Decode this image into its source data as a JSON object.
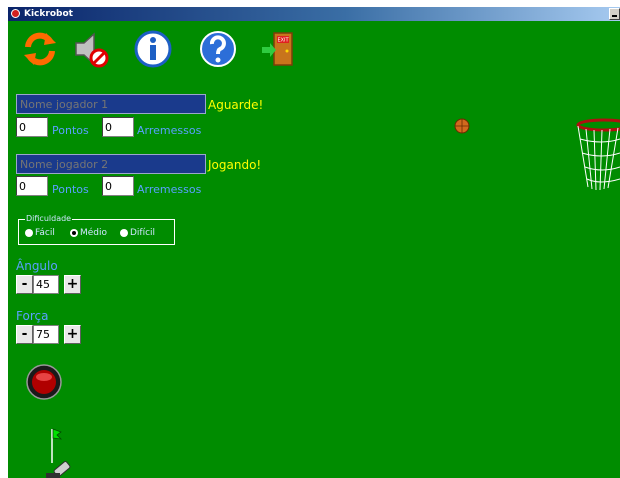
{
  "window": {
    "title": "Kickrobot"
  },
  "colors": {
    "field": "#008c00",
    "status": "#ffff00",
    "label": "#5aa0ff",
    "input_bg": "#1a3a8c"
  },
  "toolbar": {
    "items": [
      {
        "icon": "restart-icon"
      },
      {
        "icon": "sound-off-icon"
      },
      {
        "icon": "info-icon"
      },
      {
        "icon": "help-icon"
      },
      {
        "icon": "exit-door-icon",
        "text": "EXIT"
      }
    ]
  },
  "players": [
    {
      "name_placeholder": "Nome jogador 1",
      "status": "Aguarde!",
      "points": "0",
      "points_label": "Pontos",
      "throws": "0",
      "throws_label": "Arremessos"
    },
    {
      "name_placeholder": "Nome jogador 2",
      "status": "Jogando!",
      "points": "0",
      "points_label": "Pontos",
      "throws": "0",
      "throws_label": "Arremessos"
    }
  ],
  "difficulty": {
    "legend": "Dificuldade",
    "options": [
      "Fácil",
      "Médio",
      "Difícil"
    ],
    "selected": "Médio"
  },
  "angle": {
    "label": "Ângulo",
    "value": "45",
    "minus": "-",
    "plus": "+"
  },
  "force": {
    "label": "Força",
    "value": "75",
    "minus": "-",
    "plus": "+"
  }
}
